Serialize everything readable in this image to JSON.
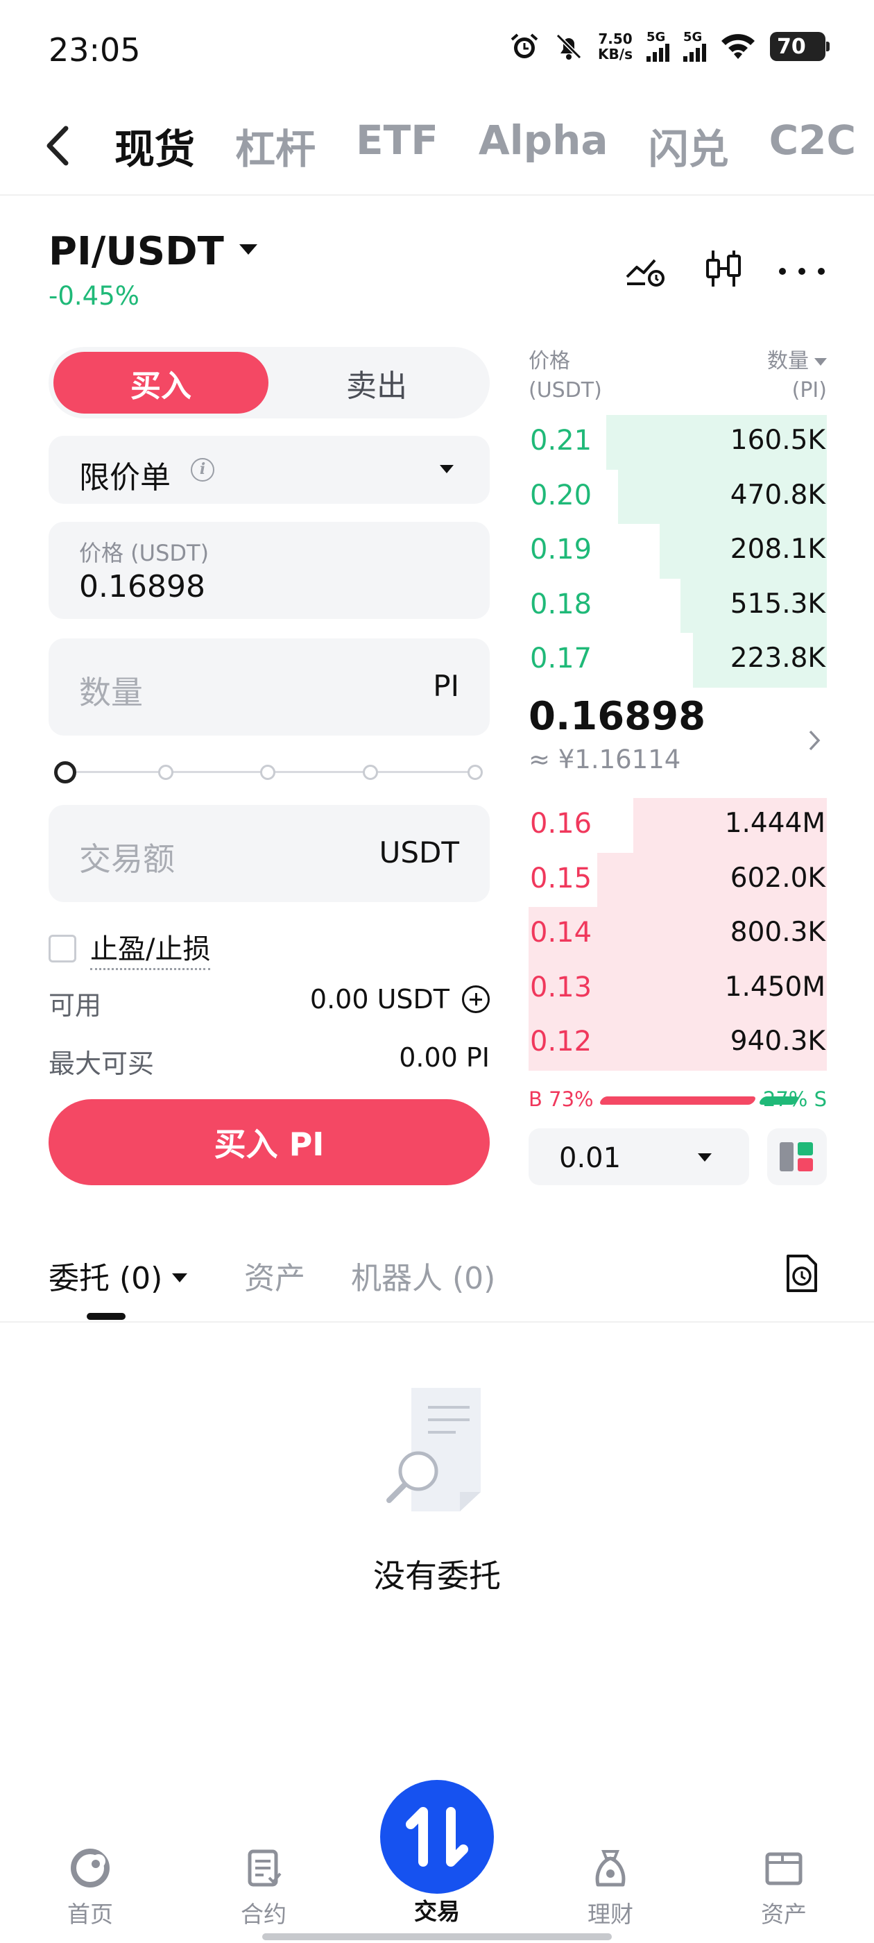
{
  "status_bar": {
    "time": "23:05",
    "net_speed_value": "7.50",
    "net_speed_unit": "KB/s",
    "sim1": "5G",
    "sim2": "5G",
    "battery": "70",
    "icons": [
      "alarm-icon",
      "bell-muted-icon",
      "signal-icon",
      "wifi-icon",
      "battery-icon"
    ]
  },
  "top_tabs": [
    {
      "label": "现货",
      "active": true
    },
    {
      "label": "杠杆",
      "active": false
    },
    {
      "label": "ETF",
      "active": false
    },
    {
      "label": "Alpha",
      "active": false
    },
    {
      "label": "闪兑",
      "active": false
    },
    {
      "label": "C2C",
      "active": false
    }
  ],
  "pair": {
    "symbol": "PI/USDT",
    "change": "-0.45%",
    "actions": [
      "price-alert-icon",
      "candlestick-icon",
      "more-icon"
    ]
  },
  "form": {
    "side_buy": "买入",
    "side_sell": "卖出",
    "order_type": "限价单",
    "price_label": "价格 (USDT)",
    "price_value": "0.16898",
    "qty_placeholder": "数量",
    "qty_unit": "PI",
    "amount_placeholder": "交易额",
    "amount_unit": "USDT",
    "slider_percent": 0,
    "tpsl_label": "止盈/止损",
    "available_label": "可用",
    "available_value": "0.00 USDT",
    "max_buy_label": "最大可买",
    "max_buy_value": "0.00 PI",
    "submit": "买入 PI"
  },
  "orderbook": {
    "price_header": "价格",
    "price_unit": "(USDT)",
    "qty_header": "数量",
    "qty_unit": "(PI)",
    "asks": [
      {
        "price": "0.21",
        "qty": "160.5K",
        "depth": 0.74
      },
      {
        "price": "0.20",
        "qty": "470.8K",
        "depth": 0.7
      },
      {
        "price": "0.19",
        "qty": "208.1K",
        "depth": 0.56
      },
      {
        "price": "0.18",
        "qty": "515.3K",
        "depth": 0.49
      },
      {
        "price": "0.17",
        "qty": "223.8K",
        "depth": 0.45
      }
    ],
    "last_price": "0.16898",
    "fiat_price": "≈ ¥1.16114",
    "bids": [
      {
        "price": "0.16",
        "qty": "1.444M",
        "depth": 0.65
      },
      {
        "price": "0.15",
        "qty": "602.0K",
        "depth": 0.77
      },
      {
        "price": "0.14",
        "qty": "800.3K",
        "depth": 1.0
      },
      {
        "price": "0.13",
        "qty": "1.450M",
        "depth": 1.0
      },
      {
        "price": "0.12",
        "qty": "940.3K",
        "depth": 1.0
      }
    ],
    "buy_ratio": "B 73%",
    "sell_ratio": "27% S",
    "buy_pct": 73,
    "tick_size": "0.01"
  },
  "orders": {
    "tabs": [
      {
        "label": "委托 (0)",
        "active": true
      },
      {
        "label": "资产",
        "active": false
      },
      {
        "label": "机器人 (0)",
        "active": false
      }
    ],
    "empty_text": "没有委托"
  },
  "bottom_nav": [
    {
      "label": "首页",
      "icon": "home-icon",
      "active": false
    },
    {
      "label": "合约",
      "icon": "futures-icon",
      "active": false
    },
    {
      "label": "交易",
      "icon": "trade-icon",
      "active": true
    },
    {
      "label": "理财",
      "icon": "earn-icon",
      "active": false
    },
    {
      "label": "资产",
      "icon": "wallet-icon",
      "active": false
    }
  ],
  "colors": {
    "buy": "#f44864",
    "sell": "#1fb978",
    "accent": "#1652f0"
  }
}
